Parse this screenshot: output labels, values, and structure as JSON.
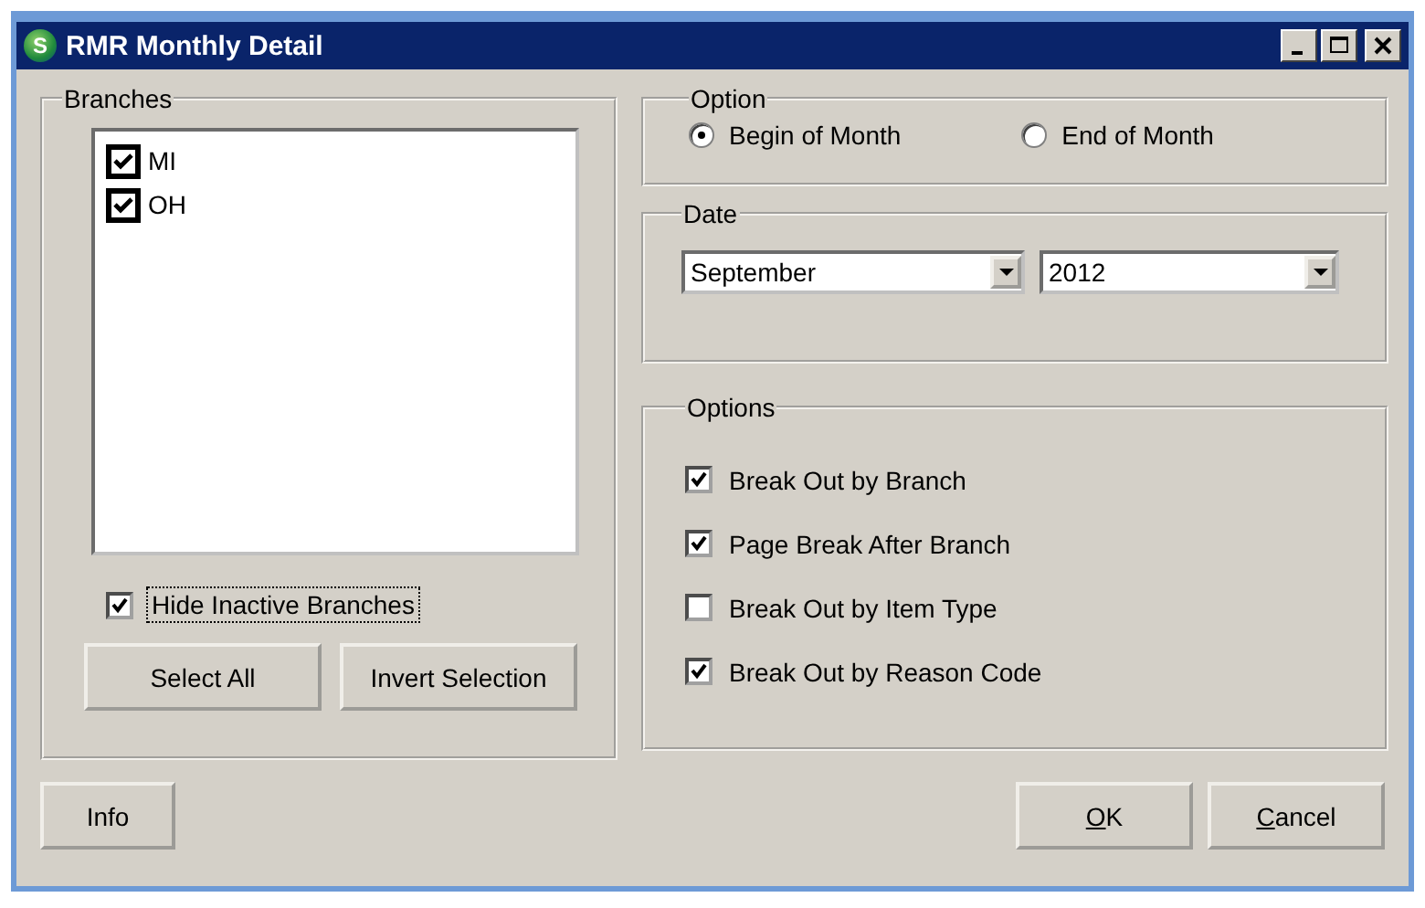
{
  "window": {
    "title": "RMR Monthly Detail",
    "logo_letter": "S"
  },
  "branches": {
    "label": "Branches",
    "items": [
      {
        "label": "MI",
        "checked": true
      },
      {
        "label": "OH",
        "checked": true
      }
    ],
    "hide_inactive": {
      "label": "Hide Inactive Branches",
      "checked": true
    },
    "buttons": [
      "Select All",
      "Invert Selection"
    ]
  },
  "option": {
    "label": "Option",
    "choices": [
      {
        "label": "Begin of Month",
        "selected": true
      },
      {
        "label": "End of Month",
        "selected": false
      }
    ]
  },
  "date": {
    "label": "Date",
    "month": "September",
    "year": "2012"
  },
  "options": {
    "label": "Options",
    "items": [
      {
        "label": "Break Out by Branch",
        "checked": true
      },
      {
        "label": "Page Break After Branch",
        "checked": true
      },
      {
        "label": "Break Out by Item Type",
        "checked": false
      },
      {
        "label": "Break Out by Reason Code",
        "checked": true
      }
    ]
  },
  "footer": {
    "info": "Info",
    "buttons": [
      {
        "label": "OK",
        "underline_first": true
      },
      {
        "label": "Cancel",
        "underline_first": true
      }
    ]
  }
}
